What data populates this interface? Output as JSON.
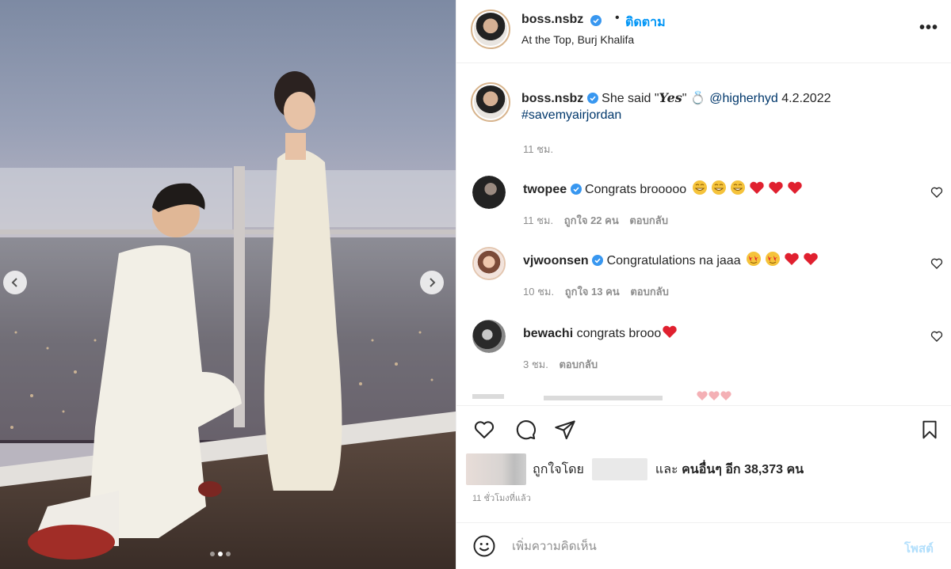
{
  "post": {
    "username": "boss.nsbz",
    "follow_label": "ติดตาม",
    "bullet": "•",
    "location": "At the Top, Burj Khalifa",
    "more_label": "•••",
    "caption": {
      "username": "boss.nsbz",
      "text_before": "She said \"",
      "yes_word": "Yes",
      "text_after": "\" 💍",
      "mention": "@higherhyd",
      "date": "4.2.2022",
      "hashtag": "#savemyairjordan",
      "time": "11 ชม."
    }
  },
  "comments": [
    {
      "username": "twopee",
      "text": "Congrats brooooo",
      "emojis": [
        "grin",
        "grin",
        "grin",
        "heart",
        "heart",
        "heart"
      ],
      "time": "11 ชม.",
      "likes": "ถูกใจ 22 คน",
      "reply": "ตอบกลับ",
      "verified": true
    },
    {
      "username": "vjwoonsen",
      "text": "Congratulations na jaaa",
      "emojis": [
        "star",
        "star",
        "heart",
        "heart"
      ],
      "time": "10 ชม.",
      "likes": "ถูกใจ 13 คน",
      "reply": "ตอบกลับ",
      "verified": true
    },
    {
      "username": "bewachi",
      "text": "congrats brooo",
      "emojis": [
        "heart"
      ],
      "time": "3 ชม.",
      "likes": "",
      "reply": "ตอบกลับ",
      "verified": false
    }
  ],
  "likes_bar": {
    "liked_by": "ถูกใจโดย",
    "and": "และ",
    "others": "คนอื่นๆ อีก 38,373 คน"
  },
  "time_ago": "11 ชั่วโมงที่แล้ว",
  "add_comment": {
    "placeholder": "เพิ่มความคิดเห็น",
    "post_label": "โพสต์"
  },
  "colors": {
    "link": "#0095f6",
    "verified": "#3897f0",
    "heart": "#ed4956",
    "muted": "#8e8e8e"
  },
  "icons": [
    "heart-icon",
    "comment-icon",
    "share-icon",
    "bookmark-icon",
    "emoji-icon",
    "chevron-left-icon",
    "chevron-right-icon"
  ]
}
